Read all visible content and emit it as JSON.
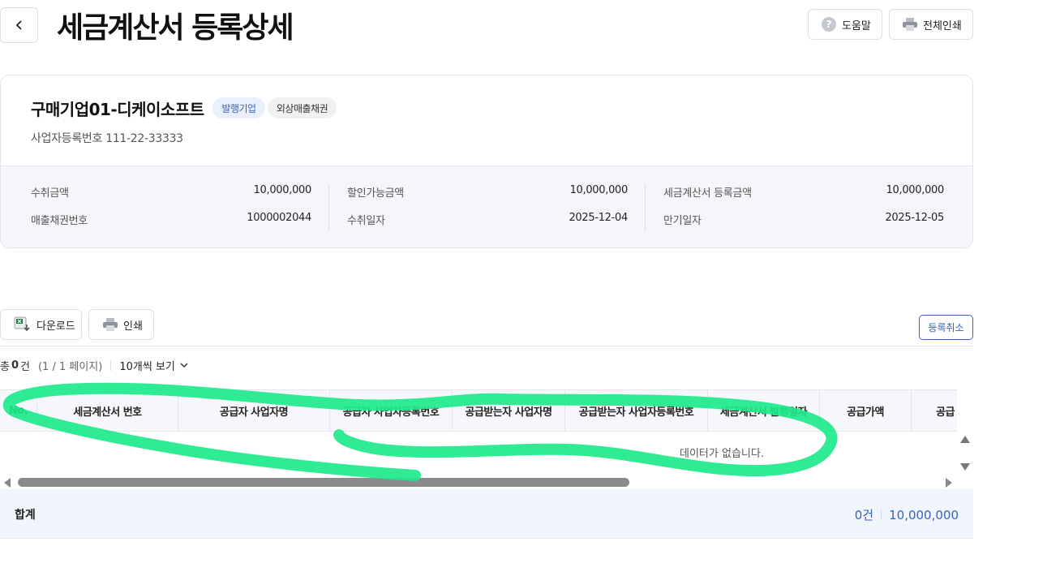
{
  "header": {
    "title": "세금계산서 등록상세",
    "help_label": "도움말",
    "print_all_label": "전체인쇄"
  },
  "company": {
    "name": "구매기업01-디케이소프트",
    "badges": [
      "발행기업",
      "외상매출채권"
    ],
    "biz_reg_no": "사업자등록번호 111-22-33333"
  },
  "summary": {
    "col1": [
      {
        "label": "수취금액",
        "value": "10,000,000"
      },
      {
        "label": "매출채권번호",
        "value": "1000002044"
      }
    ],
    "col2": [
      {
        "label": "할인가능금액",
        "value": "10,000,000"
      },
      {
        "label": "수취일자",
        "value": "2025-12-04"
      }
    ],
    "col3": [
      {
        "label": "세금계산서 등록금액",
        "value": "10,000,000"
      },
      {
        "label": "만기일자",
        "value": "2025-12-05"
      }
    ]
  },
  "toolbar": {
    "download_label": "다운로드",
    "print_label": "인쇄",
    "cancel_registration_label": "등록취소"
  },
  "list_info": {
    "total_prefix": "총",
    "count": "0",
    "count_unit": "건",
    "pages": "(1 / 1 페이지)",
    "per_page": "10개씩 보기"
  },
  "grid": {
    "columns": [
      "No.",
      "세금계산서 번호",
      "공급자 사업자명",
      "공급자 사업자등록번호",
      "공급받는자 사업자명",
      "공급받는자 사업자등록번호",
      "세금계산서 발행일자",
      "공급가액",
      "공급"
    ],
    "empty_message": "데이터가 없습니다."
  },
  "totals": {
    "label": "합계",
    "count": "0건",
    "amount": "10,000,000"
  },
  "colors": {
    "accent": "#3a63b8",
    "annotation": "#1de98b"
  },
  "icons": [
    "chevron-left-icon",
    "help-icon",
    "printer-icon",
    "excel-download-icon",
    "chevron-down-icon"
  ]
}
